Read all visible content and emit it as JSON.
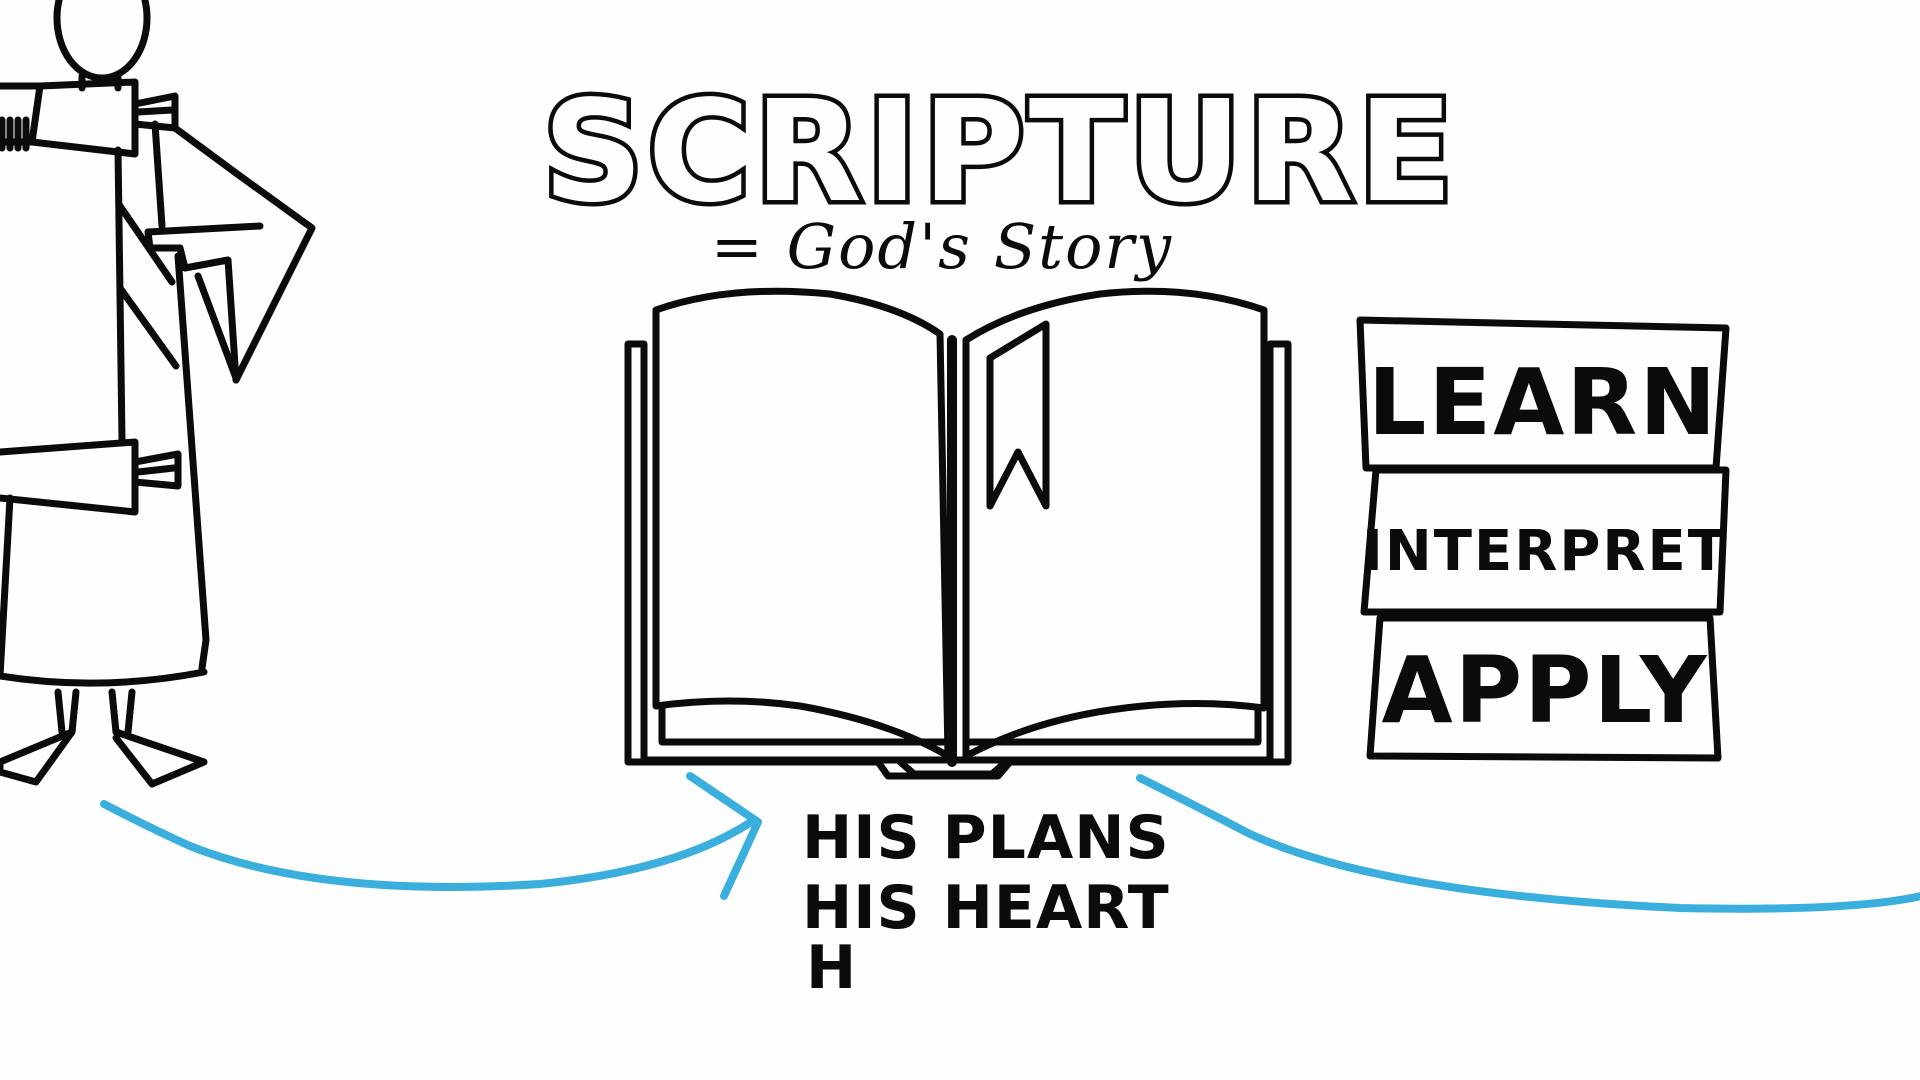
{
  "title": "SCRIPTURE",
  "subtitle": "= God's Story",
  "action_boxes": [
    "LEARN",
    "INTERPRET",
    "APPLY"
  ],
  "list_lines": [
    "HIS PLANS",
    "HIS HEART",
    "H"
  ],
  "colors": {
    "ink": "#0b0b0b",
    "accent": "#3aaedc",
    "background": "#fefefe"
  },
  "icons": [
    "person-figure-icon",
    "open-book-icon",
    "bookmark-icon",
    "arrow-icon"
  ]
}
